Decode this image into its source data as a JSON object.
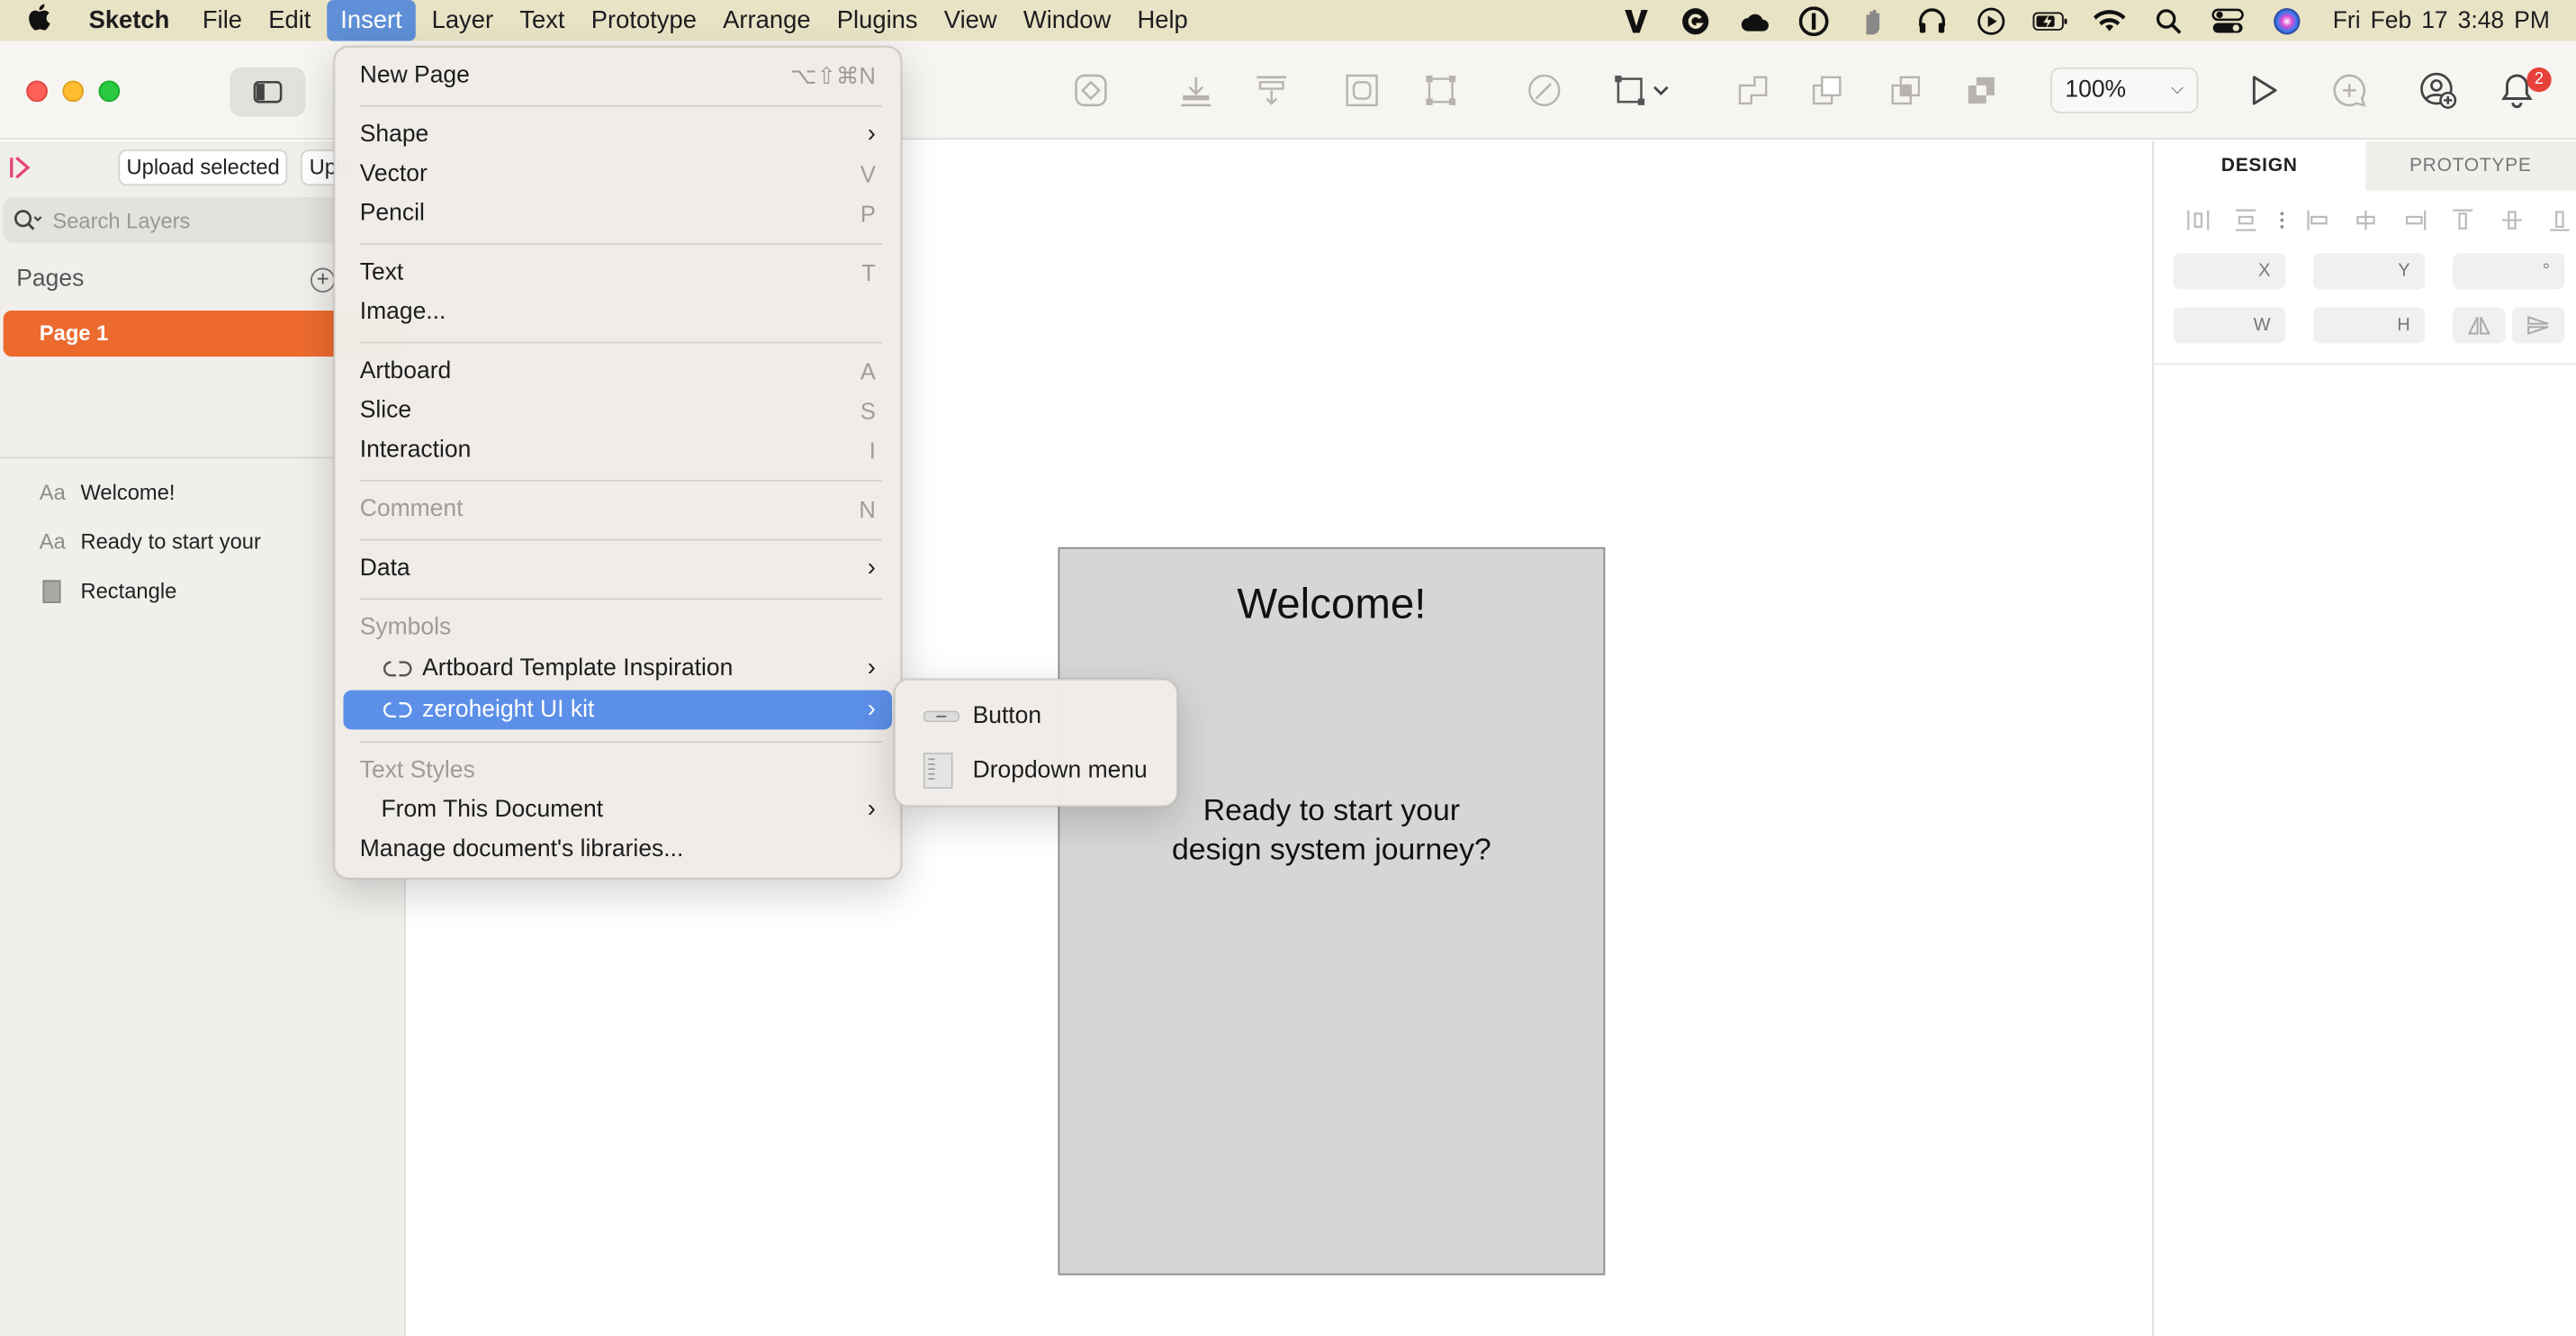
{
  "menubar": {
    "app_name": "Sketch",
    "items": [
      "File",
      "Edit",
      "Insert",
      "Layer",
      "Text",
      "Prototype",
      "Arrange",
      "Plugins",
      "View",
      "Window",
      "Help"
    ],
    "active_item": "Insert",
    "clock": "Fri Feb 17  3:48 PM",
    "status_icons": [
      "vectorworks-icon",
      "grammarly-icon",
      "creative-cloud-icon",
      "onepassword-icon",
      "hand-icon",
      "headphones-icon",
      "play-circle-icon",
      "battery-icon",
      "wifi-icon",
      "search-icon",
      "control-center-icon",
      "siri-icon"
    ]
  },
  "toolbar": {
    "zoom_value": "100%",
    "notification_count": "2"
  },
  "left_panel": {
    "upload_selected": "Upload selected",
    "upload_partial": "Uplo",
    "search_placeholder": "Search Layers",
    "pages_header": "Pages",
    "pages": [
      "Page 1"
    ],
    "layers": [
      {
        "icon": "Aa",
        "name": "Welcome!"
      },
      {
        "icon": "Aa",
        "name": "Ready to start your"
      },
      {
        "icon": "rect",
        "name": "Rectangle"
      }
    ]
  },
  "artboard": {
    "title": "Welcome!",
    "subtitle_line1": "Ready to start your",
    "subtitle_line2": "design system journey?"
  },
  "inspector": {
    "tab_design": "DESIGN",
    "tab_prototype": "PROTOTYPE",
    "field_x": "X",
    "field_y": "Y",
    "field_rotation": "°",
    "field_w": "W",
    "field_h": "H"
  },
  "insert_menu": {
    "new_page": "New Page",
    "new_page_shortcut": "⌥⇧⌘N",
    "shape": "Shape",
    "vector": "Vector",
    "vector_shortcut": "V",
    "pencil": "Pencil",
    "pencil_shortcut": "P",
    "text": "Text",
    "text_shortcut": "T",
    "image": "Image...",
    "artboard": "Artboard",
    "artboard_shortcut": "A",
    "slice": "Slice",
    "slice_shortcut": "S",
    "interaction": "Interaction",
    "interaction_shortcut": "I",
    "comment": "Comment",
    "comment_shortcut": "N",
    "data": "Data",
    "symbols_header": "Symbols",
    "symbol_lib_1": "Artboard Template Inspiration",
    "symbol_lib_2": "zeroheight UI kit",
    "text_styles_header": "Text Styles",
    "from_this_document": "From This Document",
    "manage_libraries": "Manage document's libraries..."
  },
  "submenu": {
    "items": [
      "Button",
      "Dropdown menu"
    ]
  },
  "colors": {
    "menubar_bg": "#e9e3c6",
    "menu_highlight": "#5c8fe8",
    "page_selected": "#ec6a2e",
    "artboard_fill": "#d6d6d6"
  }
}
